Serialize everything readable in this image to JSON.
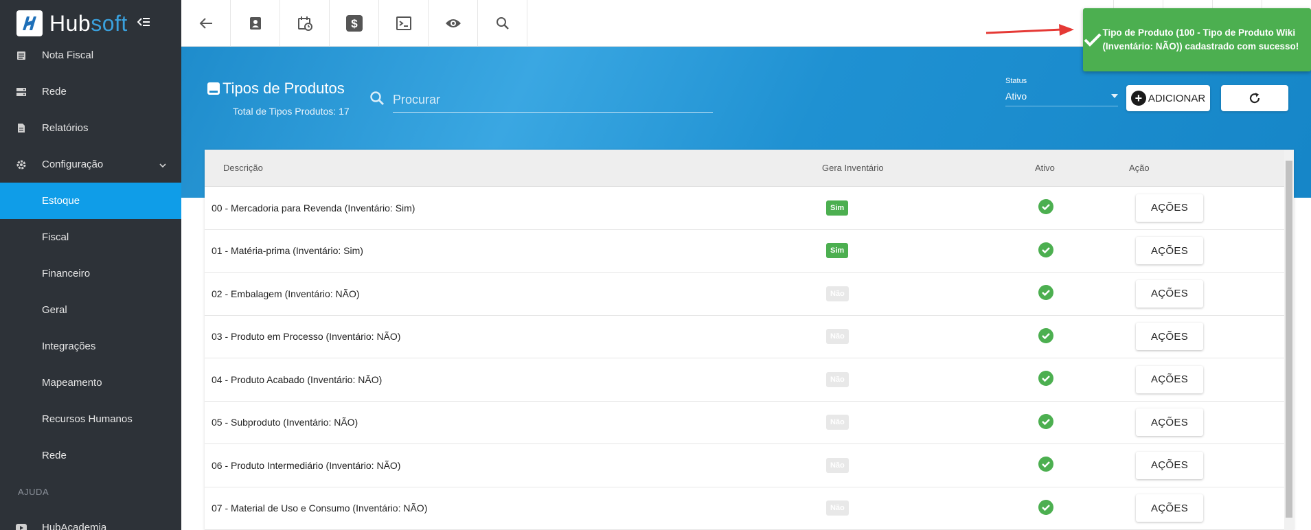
{
  "app": {
    "logo_hub": "Hub",
    "logo_soft": "soft"
  },
  "sidebar": {
    "items": [
      {
        "label": "Nota Fiscal",
        "icon": "list-icon"
      },
      {
        "label": "Rede",
        "icon": "server-icon"
      },
      {
        "label": "Relatórios",
        "icon": "document-icon"
      },
      {
        "label": "Configuração",
        "icon": "gear-icon"
      }
    ],
    "sub_items": [
      {
        "label": "Estoque",
        "active": true
      },
      {
        "label": "Fiscal"
      },
      {
        "label": "Financeiro"
      },
      {
        "label": "Geral"
      },
      {
        "label": "Integrações"
      },
      {
        "label": "Mapeamento"
      },
      {
        "label": "Recursos Humanos"
      },
      {
        "label": "Rede"
      }
    ],
    "section_label": "AJUDA",
    "help_item": {
      "label": "HubAcademia",
      "icon": "youtube-icon"
    }
  },
  "toolbar": {
    "icons": [
      "back-arrow-icon",
      "contact-card-icon",
      "calendar-clock-icon",
      "dollar-icon",
      "terminal-icon",
      "eye-icon",
      "search-icon"
    ]
  },
  "header": {
    "title": "Tipos de Produtos",
    "total": "Total de Tipos Produtos: 17",
    "search_placeholder": "Procurar",
    "status_label": "Status",
    "status_value": "Ativo",
    "add_label": "ADICIONAR"
  },
  "toast": {
    "message": "Tipo de Produto (100 - Tipo de Produto Wiki (Inventário: NÃO)) cadastrado com sucesso!",
    "color": "#4caf50"
  },
  "table": {
    "columns": {
      "descricao": "Descrição",
      "gera": "Gera Inventário",
      "ativo": "Ativo",
      "acao": "Ação"
    },
    "action_label": "AÇÕES",
    "rows": [
      {
        "descricao": "00 - Mercadoria para Revenda (Inventário: Sim)",
        "gera": "Sim"
      },
      {
        "descricao": "01 - Matéria-prima (Inventário: Sim)",
        "gera": "Sim"
      },
      {
        "descricao": "02 - Embalagem (Inventário: NÃO)",
        "gera": "Não"
      },
      {
        "descricao": "03 - Produto em Processo (Inventário: NÃO)",
        "gera": "Não"
      },
      {
        "descricao": "04 - Produto Acabado (Inventário: NÃO)",
        "gera": "Não"
      },
      {
        "descricao": "05 - Subproduto (Inventário: NÃO)",
        "gera": "Não"
      },
      {
        "descricao": "06 - Produto Intermediário (Inventário: NÃO)",
        "gera": "Não"
      },
      {
        "descricao": "07 - Material de Uso e Consumo (Inventário: NÃO)",
        "gera": "Não"
      }
    ]
  },
  "colors": {
    "sidebar_bg": "#2d3238",
    "accent": "#0f9de8",
    "success": "#4caf50"
  }
}
